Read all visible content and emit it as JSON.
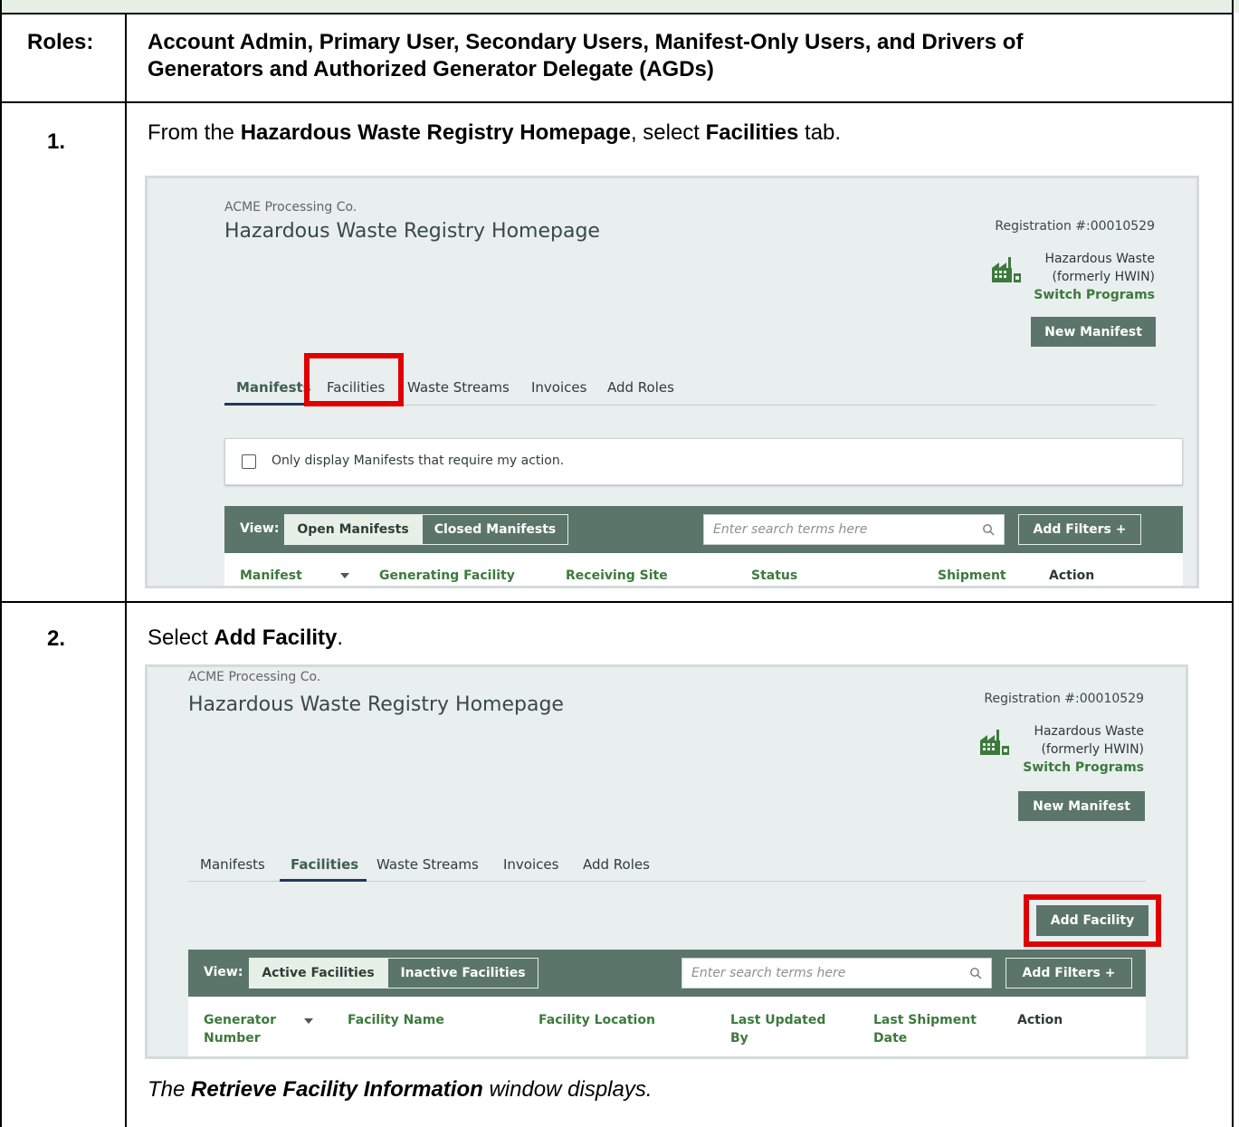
{
  "doc": {
    "roles_label": "Roles:",
    "roles_line1": "Account Admin, Primary User, Secondary Users, Manifest-Only Users, and Drivers of",
    "roles_line2": "Generators and Authorized Generator Delegate (AGDs)",
    "step1_num": "1.",
    "step1_a": "From the ",
    "step1_b": "Hazardous Waste Registry Homepage",
    "step1_c": ", select ",
    "step1_d": "Facilities",
    "step1_e": " tab.",
    "step2_num": "2.",
    "step2_a": "Select ",
    "step2_b": "Add Facility",
    "step2_c": ".",
    "result_a": "The ",
    "result_b": "Retrieve Facility Information",
    "result_c": " window displays."
  },
  "screen1": {
    "company": "ACME Processing Co.",
    "title": "Hazardous Waste Registry Homepage",
    "registration": "Registration #:00010529",
    "program_line1": "Hazardous Waste",
    "program_line2": "(formerly HWIN)",
    "switch_programs": "Switch Programs",
    "new_manifest": "New Manifest",
    "tabs": [
      "Manifests",
      "Facilities",
      "Waste Streams",
      "Invoices",
      "Add Roles"
    ],
    "active_tab": "Manifests",
    "checkbox_label": "Only display Manifests that require my action.",
    "view_label": "View:",
    "view_on": "Open Manifests",
    "view_off": "Closed Manifests",
    "search_placeholder": "Enter search terms here",
    "add_filters": "Add Filters +",
    "columns": [
      "Manifest",
      "Generating Facility",
      "Receiving Site",
      "Status",
      "Shipment",
      "Action"
    ]
  },
  "screen2": {
    "company": "ACME Processing Co.",
    "title": "Hazardous Waste Registry Homepage",
    "registration": "Registration #:00010529",
    "program_line1": "Hazardous Waste",
    "program_line2": "(formerly HWIN)",
    "switch_programs": "Switch Programs",
    "new_manifest": "New Manifest",
    "tabs": [
      "Manifests",
      "Facilities",
      "Waste Streams",
      "Invoices",
      "Add Roles"
    ],
    "active_tab": "Facilities",
    "add_facility": "Add Facility",
    "view_label": "View:",
    "view_on": "Active Facilities",
    "view_off": "Inactive Facilities",
    "search_placeholder": "Enter search terms here",
    "add_filters": "Add Filters +",
    "columns": [
      {
        "line1": "Generator",
        "line2": "Number"
      },
      {
        "line1": "Facility Name",
        "line2": ""
      },
      {
        "line1": "Facility Location",
        "line2": ""
      },
      {
        "line1": "Last Updated",
        "line2": "By"
      },
      {
        "line1": "Last Shipment",
        "line2": "Date"
      },
      {
        "line1": "Action",
        "line2": ""
      }
    ]
  },
  "icons": [
    "factory-icon",
    "search-icon",
    "caret-down-icon"
  ],
  "colors": {
    "accent_green": "#3c7a3c",
    "header_bar": "#5b756a",
    "highlight_red": "#e00000",
    "tab_underline": "#1e3a5c"
  }
}
